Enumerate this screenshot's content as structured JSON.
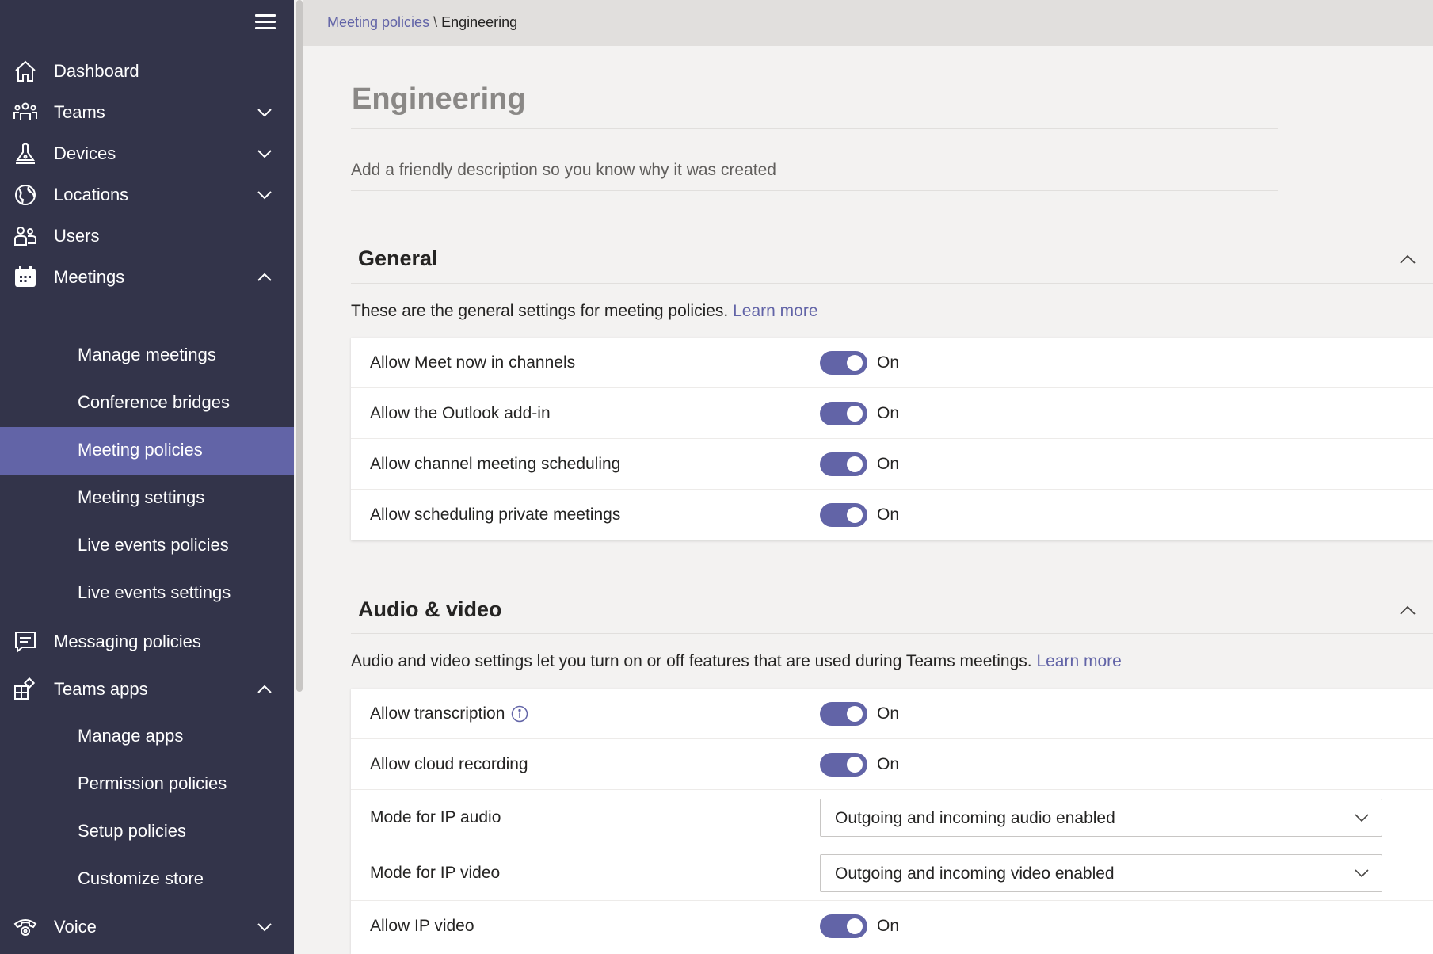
{
  "breadcrumb": {
    "parent": "Meeting policies",
    "separator": " \\ ",
    "current": "Engineering"
  },
  "sidebar": {
    "items": [
      {
        "label": "Dashboard",
        "icon": "home-icon"
      },
      {
        "label": "Teams",
        "icon": "teams-icon",
        "expanded": false
      },
      {
        "label": "Devices",
        "icon": "devices-icon",
        "expanded": false
      },
      {
        "label": "Locations",
        "icon": "globe-icon",
        "expanded": false
      },
      {
        "label": "Users",
        "icon": "users-icon"
      },
      {
        "label": "Meetings",
        "icon": "calendar-icon",
        "expanded": true
      },
      {
        "label": "Messaging policies",
        "icon": "message-icon"
      },
      {
        "label": "Teams apps",
        "icon": "apps-icon",
        "expanded": true
      },
      {
        "label": "Voice",
        "icon": "phone-icon",
        "expanded": false
      }
    ],
    "meetings_sub": [
      "Manage meetings",
      "Conference bridges",
      "Meeting policies",
      "Meeting settings",
      "Live events policies",
      "Live events settings"
    ],
    "apps_sub": [
      "Manage apps",
      "Permission policies",
      "Setup policies",
      "Customize store"
    ],
    "active_item": "Meeting policies"
  },
  "page": {
    "title": "Engineering",
    "description_placeholder": "Add a friendly description so you know why it was created"
  },
  "general": {
    "title": "General",
    "description": "These are the general settings for meeting policies.",
    "learn_more": "Learn more",
    "settings": [
      {
        "label": "Allow Meet now in channels",
        "state": "On"
      },
      {
        "label": "Allow the Outlook add-in",
        "state": "On"
      },
      {
        "label": "Allow channel meeting scheduling",
        "state": "On"
      },
      {
        "label": "Allow scheduling private meetings",
        "state": "On"
      }
    ]
  },
  "audio_video": {
    "title": "Audio & video",
    "description": "Audio and video settings let you turn on or off features that are used during Teams meetings.",
    "learn_more": "Learn more",
    "settings": [
      {
        "label": "Allow transcription",
        "state": "On"
      },
      {
        "label": "Allow cloud recording",
        "state": "On"
      },
      {
        "label": "Mode for IP audio",
        "value": "Outgoing and incoming audio enabled"
      },
      {
        "label": "Mode for IP video",
        "value": "Outgoing and incoming video enabled"
      },
      {
        "label": "Allow IP video",
        "state": "On"
      }
    ]
  },
  "colors": {
    "sidebar_bg": "#33344a",
    "accent": "#6264a7",
    "content_bg": "#f3f2f1"
  }
}
